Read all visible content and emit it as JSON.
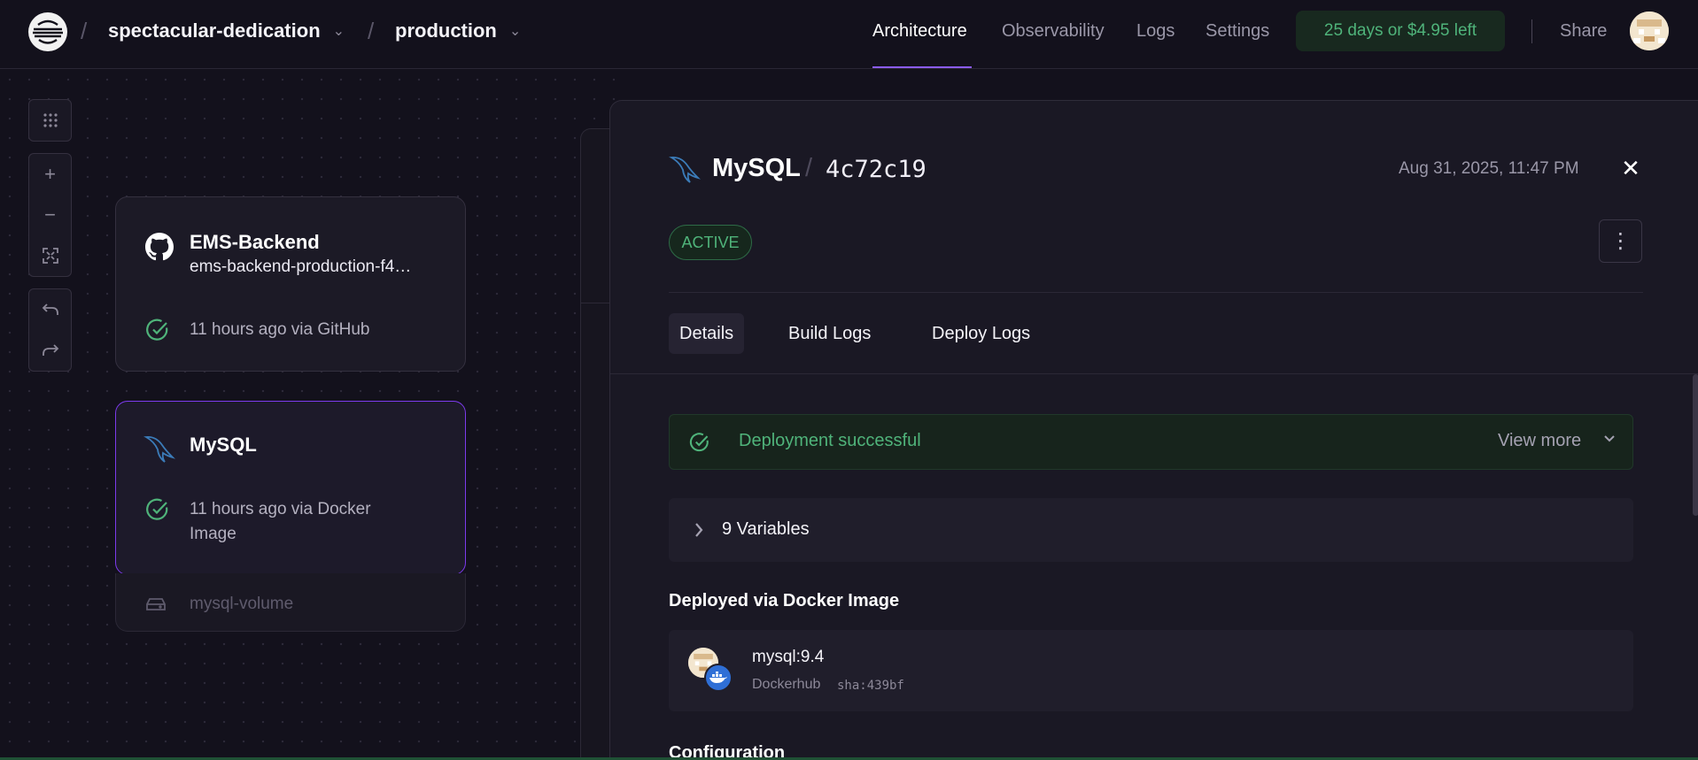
{
  "nav": {
    "project": "spectacular-dedication",
    "environment": "production",
    "separator": "/",
    "tabs": [
      {
        "label": "Architecture",
        "active": true
      },
      {
        "label": "Observability",
        "active": false
      },
      {
        "label": "Logs",
        "active": false
      },
      {
        "label": "Settings",
        "active": false
      }
    ],
    "trial": "25 days or $4.95 left",
    "share": "Share"
  },
  "canvas": {
    "tools": [
      "grid-icon",
      "zoom-in-icon",
      "zoom-out-icon",
      "fit-view-icon",
      "undo-icon",
      "redo-icon"
    ],
    "services": [
      {
        "name": "EMS-Backend",
        "domain": "ems-backend-production-f4…",
        "status": "11 hours ago via GitHub",
        "icon": "github-icon"
      },
      {
        "name": "MySQL",
        "status_line1": "11 hours ago via Docker",
        "status_line2": "Image",
        "icon": "mysql-dolphin-icon"
      }
    ],
    "volume": "mysql-volume"
  },
  "panel": {
    "title": "MySQL",
    "slash": "/",
    "hash": "4c72c19",
    "date": "Aug 31, 2025, 11:47 PM",
    "badge": "ACTIVE",
    "tabs": [
      "Details",
      "Build Logs",
      "Deploy Logs"
    ],
    "deployment_status": "Deployment successful",
    "view_more": "View more",
    "variables": "9 Variables",
    "deployed_via_heading": "Deployed via Docker Image",
    "image": {
      "name": "mysql:9.4",
      "source": "Dockerhub",
      "sha": "sha:439bf"
    },
    "config_heading": "Configuration"
  },
  "colors": {
    "accent": "#8b5cf6",
    "success": "#4fb37a",
    "background": "#13111c"
  }
}
